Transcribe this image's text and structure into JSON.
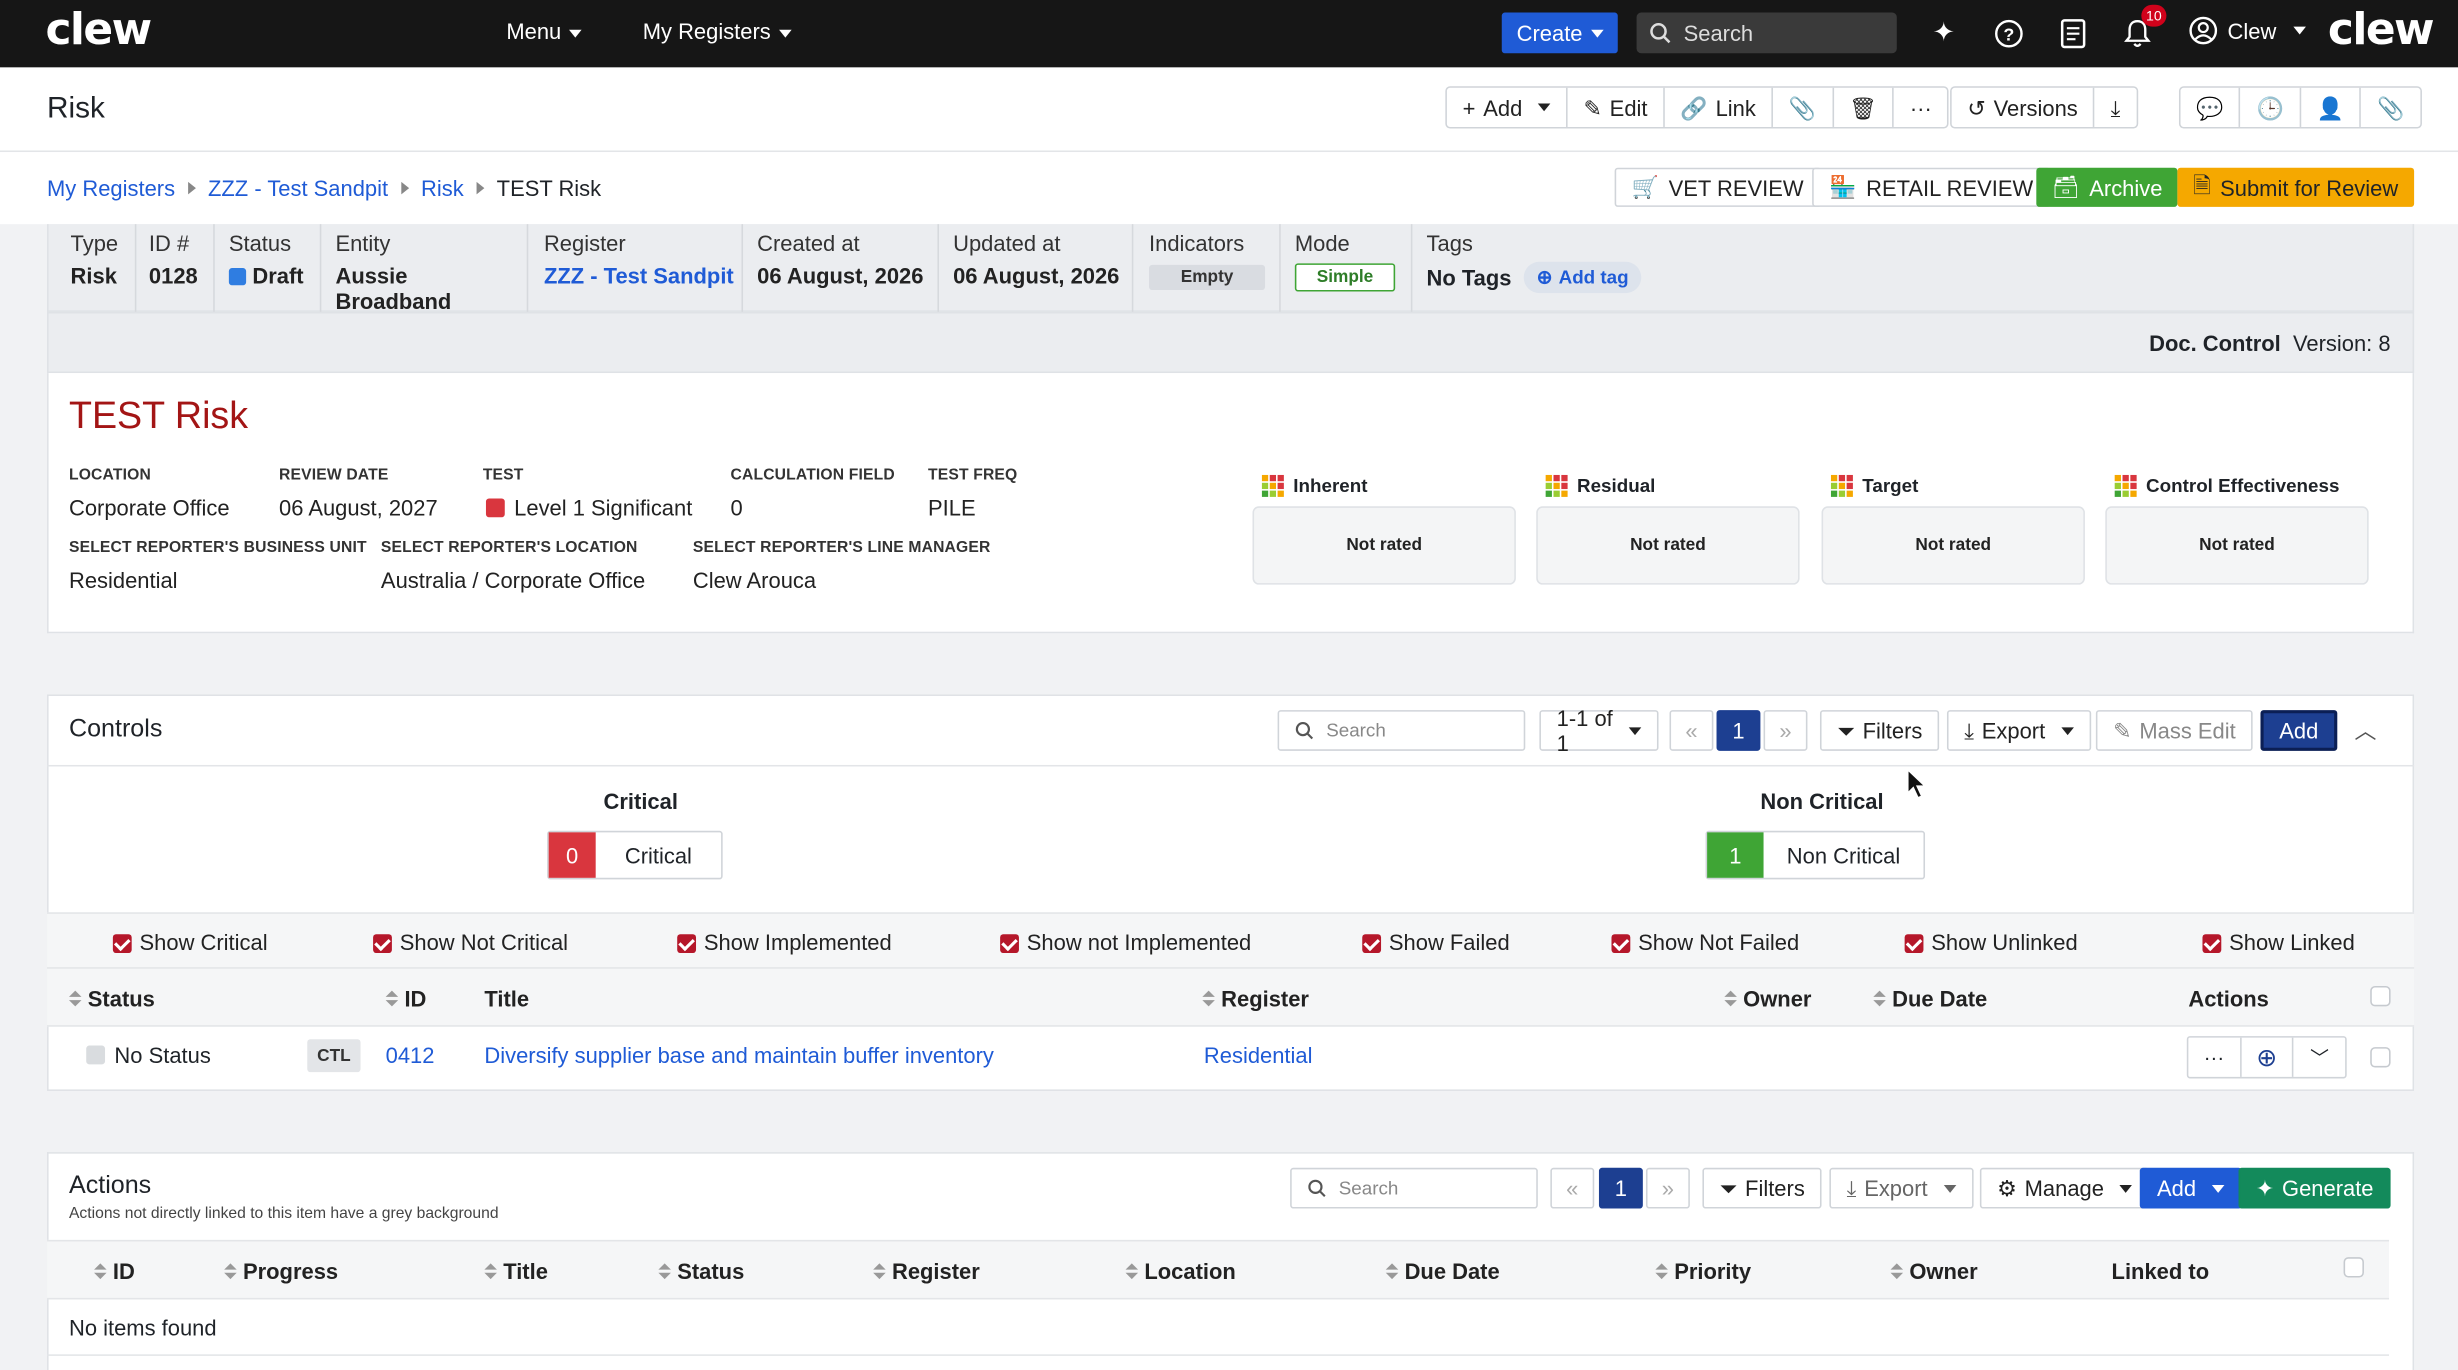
{
  "nav": {
    "logo": "clew",
    "menu": "Menu",
    "my_registers": "My Registers",
    "create": "Create",
    "search": "Search",
    "notif_count": "10",
    "user": "Clew",
    "brand_right": "clew"
  },
  "page": {
    "title": "Risk",
    "toolbar": {
      "add": "Add",
      "edit": "Edit",
      "link": "Link",
      "versions": "Versions"
    }
  },
  "breadcrumb": [
    "My Registers",
    "ZZZ - Test Sandpit",
    "Risk",
    "TEST Risk"
  ],
  "review_buttons": {
    "vet": "VET REVIEW",
    "retail": "RETAIL REVIEW",
    "archive": "Archive",
    "submit": "Submit for Review"
  },
  "info": {
    "type_label": "Type",
    "type": "Risk",
    "id_label": "ID #",
    "id": "0128",
    "status_label": "Status",
    "status": "Draft",
    "entity_label": "Entity",
    "entity": "Aussie Broadband",
    "register_label": "Register",
    "register": "ZZZ - Test Sandpit",
    "created_label": "Created at",
    "created": "06 August, 2026",
    "updated_label": "Updated at",
    "updated": "06 August, 2026",
    "indicators_label": "Indicators",
    "indicators": "Empty",
    "mode_label": "Mode",
    "mode": "Simple",
    "tags_label": "Tags",
    "tags": "No Tags",
    "add_tag": "Add tag"
  },
  "doc_control": {
    "label": "Doc. Control",
    "version": "Version: 8"
  },
  "risk": {
    "title": "TEST Risk",
    "fields": {
      "location_label": "LOCATION",
      "location": "Corporate Office",
      "review_date_label": "REVIEW DATE",
      "review_date": "06 August, 2027",
      "test_label": "TEST",
      "test": "Level 1 Significant",
      "calc_label": "CALCULATION FIELD",
      "calc": "0",
      "freq_label": "TEST FREQ",
      "freq": "PILE",
      "bu_label": "SELECT REPORTER'S BUSINESS UNIT",
      "bu": "Residential",
      "rloc_label": "SELECT REPORTER'S LOCATION",
      "rloc": "Australia / Corporate Office",
      "lm_label": "SELECT REPORTER'S LINE MANAGER",
      "lm": "Clew Arouca"
    },
    "ratings": [
      {
        "label": "Inherent",
        "value": "Not rated"
      },
      {
        "label": "Residual",
        "value": "Not rated"
      },
      {
        "label": "Target",
        "value": "Not rated"
      },
      {
        "label": "Control Effectiveness",
        "value": "Not rated"
      }
    ]
  },
  "controls": {
    "title": "Controls",
    "search_placeholder": "Search",
    "range": "1-1 of 1",
    "page": "1",
    "filters": "Filters",
    "export": "Export",
    "mass_edit": "Mass Edit",
    "add": "Add",
    "critical_title": "Critical",
    "critical_count": "0",
    "critical_label": "Critical",
    "noncritical_title": "Non Critical",
    "noncritical_count": "1",
    "noncritical_label": "Non Critical",
    "filters_list": [
      "Show Critical",
      "Show Not Critical",
      "Show Implemented",
      "Show not Implemented",
      "Show Failed",
      "Show Not Failed",
      "Show Unlinked",
      "Show Linked"
    ],
    "columns": [
      "Status",
      "ID",
      "Title",
      "Register",
      "Owner",
      "Due Date",
      "Actions"
    ],
    "row": {
      "status": "No Status",
      "tag": "CTL",
      "id": "0412",
      "title": "Diversify supplier base and maintain buffer inventory",
      "register": "Residential"
    }
  },
  "actions": {
    "title": "Actions",
    "subtitle": "Actions not directly linked to this item have a grey background",
    "search_placeholder": "Search",
    "page": "1",
    "filters": "Filters",
    "export": "Export",
    "manage": "Manage",
    "add": "Add",
    "generate": "Generate",
    "columns": [
      "ID",
      "Progress",
      "Title",
      "Status",
      "Register",
      "Location",
      "Due Date",
      "Priority",
      "Owner",
      "Linked to"
    ],
    "empty": "No items found"
  },
  "colors": {
    "brand_blue": "#1f5bd6",
    "risk_title": "#a31515",
    "archive": "#3fa535",
    "submit": "#f5a800",
    "critical": "#d9363e",
    "noncritical": "#3fa535"
  }
}
